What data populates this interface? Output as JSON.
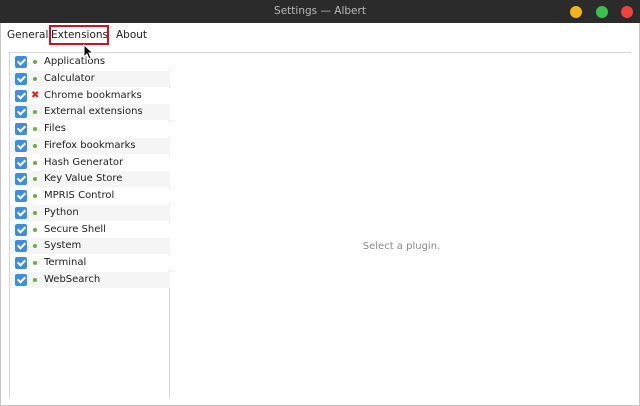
{
  "window": {
    "title": "Settings — Albert",
    "colors": {
      "minimize": "#f4b319",
      "maximize": "#3ac04b",
      "close": "#f0413b"
    }
  },
  "tabs": [
    {
      "label": "General"
    },
    {
      "label": "Extensions",
      "selected": true
    },
    {
      "label": "About"
    }
  ],
  "plugins": [
    {
      "label": "Applications",
      "enabled": true,
      "status": "loaded"
    },
    {
      "label": "Calculator",
      "enabled": true,
      "status": "loaded"
    },
    {
      "label": "Chrome bookmarks",
      "enabled": true,
      "status": "error",
      "status_icon": "✖"
    },
    {
      "label": "External extensions",
      "enabled": true,
      "status": "loaded"
    },
    {
      "label": "Files",
      "enabled": true,
      "status": "loaded"
    },
    {
      "label": "Firefox bookmarks",
      "enabled": true,
      "status": "loaded"
    },
    {
      "label": "Hash Generator",
      "enabled": true,
      "status": "loaded"
    },
    {
      "label": "Key Value Store",
      "enabled": true,
      "status": "loaded"
    },
    {
      "label": "MPRIS Control",
      "enabled": true,
      "status": "loaded"
    },
    {
      "label": "Python",
      "enabled": true,
      "status": "loaded"
    },
    {
      "label": "Secure Shell",
      "enabled": true,
      "status": "loaded"
    },
    {
      "label": "System",
      "enabled": true,
      "status": "loaded"
    },
    {
      "label": "Terminal",
      "enabled": true,
      "status": "loaded"
    },
    {
      "label": "WebSearch",
      "enabled": true,
      "status": "loaded"
    }
  ],
  "detail": {
    "placeholder": "Select a plugin."
  }
}
